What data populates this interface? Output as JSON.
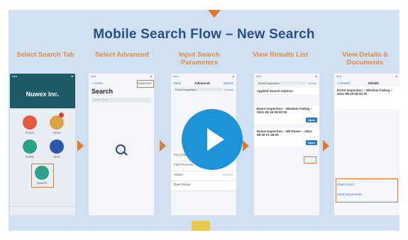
{
  "slide": {
    "title": "Mobile Search Flow – New Search",
    "steps": [
      "Select Search Tab",
      "Select Advanced",
      "Input Search Parameters",
      "View Results List",
      "View Details & Documents"
    ]
  },
  "screen1": {
    "company": "Nuwex Inc.",
    "tiles": [
      {
        "label": "Forms",
        "icon": "forms-icon",
        "color": "#e05a3e"
      },
      {
        "label": "Inbox",
        "icon": "inbox-icon",
        "color": "#d9a441"
      },
      {
        "label": "Drafts",
        "icon": "drafts-icon",
        "color": "#2aa38a"
      },
      {
        "label": "Sent",
        "icon": "sent-icon",
        "color": "#2b5aa8"
      }
    ],
    "search_label": "Search"
  },
  "screen2": {
    "back": "< Home",
    "advanced": "Advanced",
    "title": "Search",
    "placeholder": "Search text"
  },
  "screen3": {
    "nav_left": "Back",
    "nav_title": "Advanced",
    "nav_right": "Search",
    "search_value": "Event Inspection",
    "cancel": "Cancel",
    "fields": [
      "Key Date",
      "Field Process",
      "Status",
      "Date Range"
    ],
    "status_value": "Inactive"
  },
  "screen4": {
    "search_value": "Event Inspection",
    "cancel": "Cancel",
    "result1_title": "Applied Search Options",
    "result2_title": "Event Inspection – Window Fading – 2021-08-18 09:20:33",
    "result3_title": "Event Inspection – HR Power – 2021-08-18 07:48:01",
    "open_label": "Open"
  },
  "screen5": {
    "back": "< Results",
    "nav_title": "Details",
    "detail_title": "Event Inspection – Window Fading – 2021-08-18 09:20:33",
    "actions": [
      "Share Form",
      "Send Documents"
    ]
  },
  "colors": {
    "accent": "#e07a2e",
    "title": "#2a4f86",
    "play": "#1e93d9",
    "bg": "#cfe0f2"
  }
}
